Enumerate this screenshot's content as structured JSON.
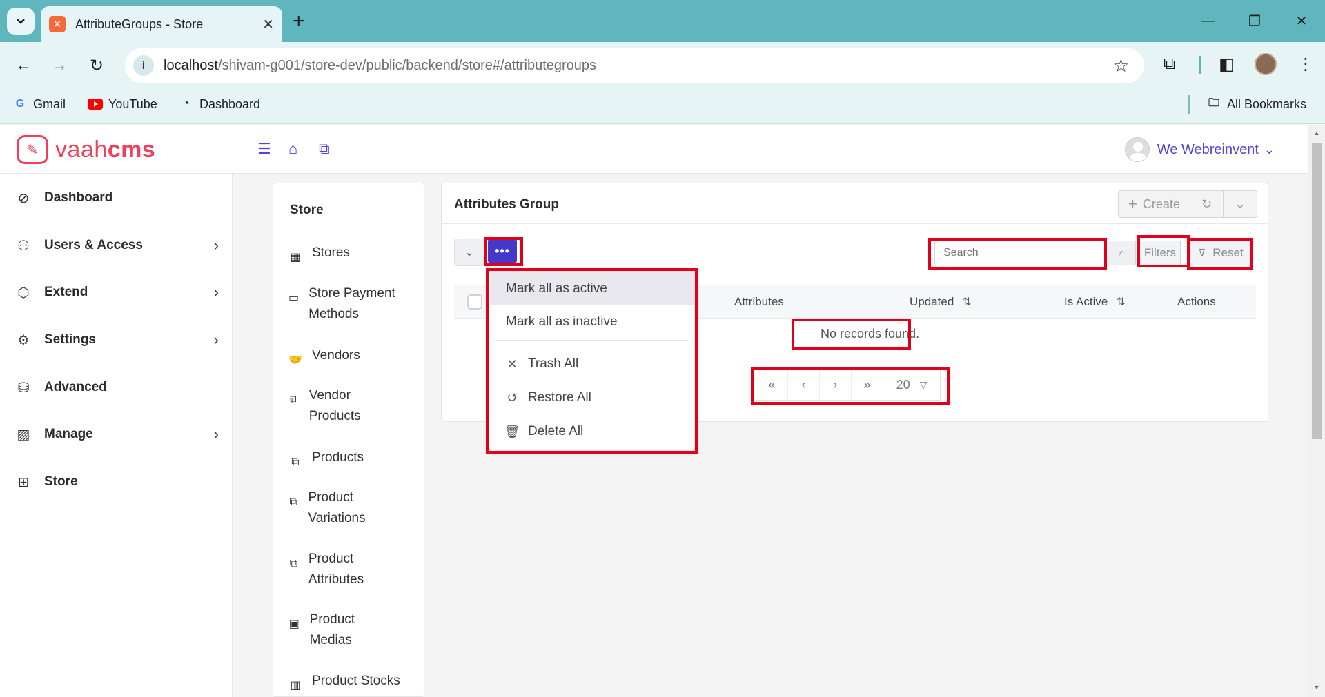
{
  "browser": {
    "tab_title": "AttributeGroups - Store",
    "url_host": "localhost",
    "url_path": "/shivam-g001/store-dev/public/backend/store#/attributegroups",
    "bookmarks": [
      "Gmail",
      "YouTube",
      "Dashboard"
    ],
    "all_bookmarks": "All Bookmarks"
  },
  "header": {
    "logo_light": "vaah",
    "logo_bold": "cms",
    "user_name": "We Webreinvent"
  },
  "sidebar": {
    "items": [
      {
        "label": "Dashboard",
        "icon": "compass-icon",
        "has_arrow": false
      },
      {
        "label": "Users & Access",
        "icon": "user-icon",
        "has_arrow": true
      },
      {
        "label": "Extend",
        "icon": "box-icon",
        "has_arrow": true
      },
      {
        "label": "Settings",
        "icon": "gear-icon",
        "has_arrow": true
      },
      {
        "label": "Advanced",
        "icon": "database-icon",
        "has_arrow": false
      },
      {
        "label": "Manage",
        "icon": "images-icon",
        "has_arrow": true
      },
      {
        "label": "Store",
        "icon": "grid-icon",
        "has_arrow": false
      }
    ]
  },
  "store_menu": {
    "title": "Store",
    "items": [
      {
        "label": "Stores"
      },
      {
        "label": "Store Payment Methods"
      },
      {
        "label": "Vendors"
      },
      {
        "label": "Vendor Products"
      },
      {
        "label": "Products"
      },
      {
        "label": "Product Variations"
      },
      {
        "label": "Product Attributes"
      },
      {
        "label": "Product Medias"
      },
      {
        "label": "Product Stocks"
      }
    ]
  },
  "main": {
    "title": "Attributes Group",
    "create_label": "Create",
    "search_placeholder": "Search",
    "filters_label": "Filters",
    "reset_label": "Reset",
    "columns": [
      "Attributes",
      "Updated",
      "Is Active",
      "Actions"
    ],
    "empty_message": "No records found.",
    "rows_per_page": "20",
    "bulk_menu": {
      "items": [
        {
          "label": "Mark all as active",
          "active": true
        },
        {
          "label": "Mark all as inactive"
        },
        {
          "label": "Trash All",
          "icon": "times-icon"
        },
        {
          "label": "Restore All",
          "icon": "undo-icon"
        },
        {
          "label": "Delete All",
          "icon": "trash-icon"
        }
      ]
    }
  },
  "colors": {
    "accent": "#4f46e5",
    "brand": "#ef3f5a",
    "highlight": "#e1001a",
    "chrome": "#5fb6bc"
  }
}
